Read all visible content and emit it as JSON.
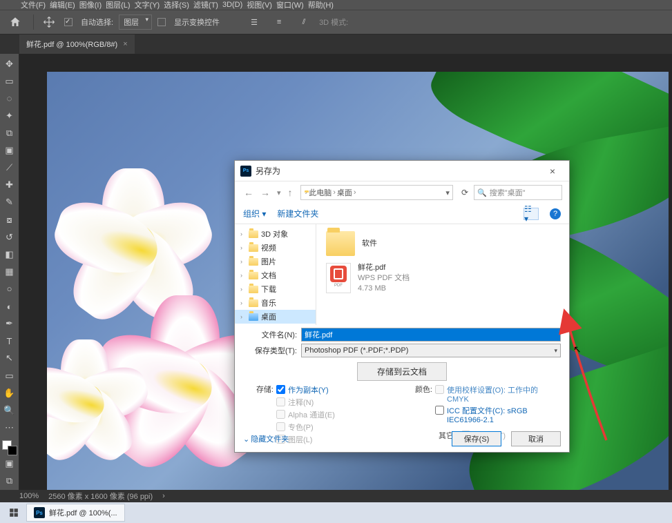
{
  "menu": {
    "file": "文件(F)",
    "edit": "编辑(E)",
    "image": "图像(I)",
    "layer": "图层(L)",
    "type": "文字(Y)",
    "select": "选择(S)",
    "filter": "滤镜(T)",
    "3d": "3D(D)",
    "view": "视图(V)",
    "window": "窗口(W)",
    "help": "帮助(H)"
  },
  "options": {
    "autoSelect": "自动选择:",
    "layerDropdown": "图层",
    "showTransform": "显示变换控件",
    "3dmode": "3D 模式:"
  },
  "tab": {
    "title": "鲜花.pdf @ 100%(RGB/8#)",
    "close": "×"
  },
  "status": {
    "zoom": "100%",
    "dims": "2560 像素 x 1600 像素 (96 ppi)"
  },
  "taskbar": {
    "app": "鲜花.pdf @ 100%(..."
  },
  "dialog": {
    "title": "另存为",
    "nav": {
      "back": "←",
      "fwd": "→",
      "up": "↑"
    },
    "path": {
      "root": "此电脑",
      "seg": "桌面"
    },
    "search": {
      "placeholder": "搜索\"桌面\""
    },
    "toolbar": {
      "organize": "组织",
      "newFolder": "新建文件夹"
    },
    "tree": [
      {
        "label": "3D 对象"
      },
      {
        "label": "视频"
      },
      {
        "label": "图片"
      },
      {
        "label": "文档"
      },
      {
        "label": "下载"
      },
      {
        "label": "音乐"
      },
      {
        "label": "桌面",
        "selected": true
      }
    ],
    "files": {
      "folder": {
        "name": "软件"
      },
      "pdf": {
        "name": "鲜花.pdf",
        "type": "WPS PDF 文档",
        "size": "4.73 MB"
      }
    },
    "form": {
      "fileNameLabel": "文件名(N):",
      "fileNameValue": "鲜花.pdf",
      "saveTypeLabel": "保存类型(T):",
      "saveTypeValue": "Photoshop PDF (*.PDF;*.PDP)"
    },
    "cloud": "存储到云文档",
    "opts": {
      "storeLabel": "存储:",
      "copy": "作为副本(Y)",
      "annot": "注释(N)",
      "alpha": "Alpha 通道(E)",
      "spot": "专色(P)",
      "layers": "图层(L)",
      "colorLabel": "颜色:",
      "proof": "使用校样设置(O):  工作中的 CMYK",
      "icc": "ICC 配置文件(C): sRGB IEC61966-2.1",
      "otherLabel": "其它:",
      "thumb": "缩览图(T)"
    },
    "footer": {
      "hide": "隐藏文件夹",
      "caret": "⌄",
      "save": "保存(S)",
      "cancel": "取消"
    }
  }
}
